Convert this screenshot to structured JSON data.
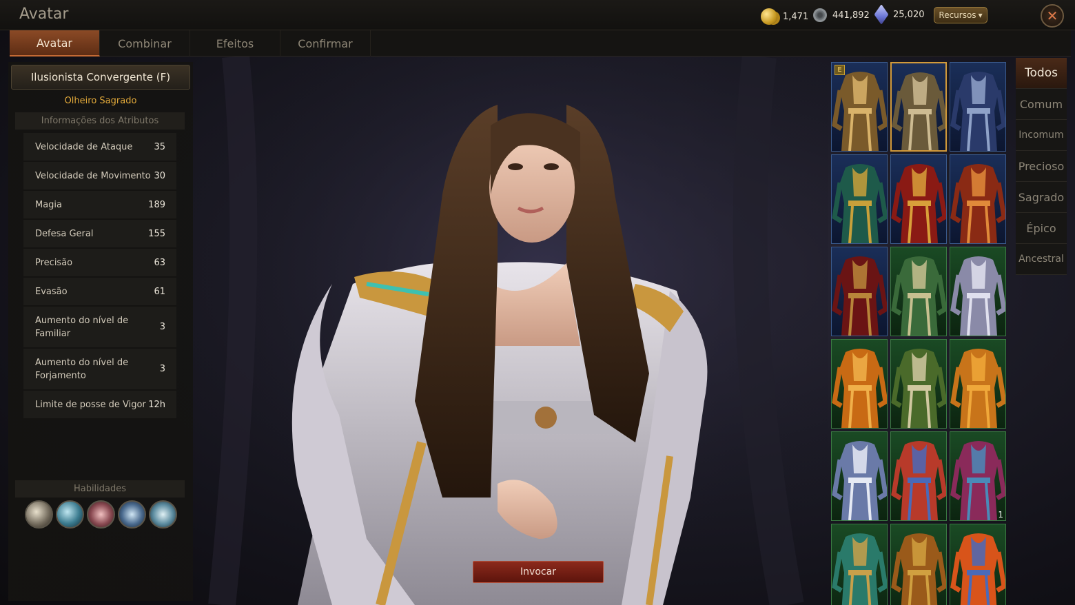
{
  "window": {
    "title": "Avatar"
  },
  "currencies": [
    {
      "icon": "gold-coin-icon",
      "value": "1,471"
    },
    {
      "icon": "silver-coin-icon",
      "value": "441,892"
    },
    {
      "icon": "crystal-icon",
      "value": "25,020"
    }
  ],
  "resources_button": {
    "label": "Recursos"
  },
  "tabs": [
    {
      "label": "Avatar",
      "active": true
    },
    {
      "label": "Combinar",
      "active": false
    },
    {
      "label": "Efeitos",
      "active": false
    },
    {
      "label": "Confirmar",
      "active": false
    }
  ],
  "character": {
    "class_name": "Ilusionista Convergente (F)",
    "grade": "Olheiro Sagrado",
    "attributes_header": "Informações dos Atributos",
    "attributes": [
      {
        "name": "Velocidade de Ataque",
        "value": "35"
      },
      {
        "name": "Velocidade de Movimento",
        "value": "30"
      },
      {
        "name": "Magia",
        "value": "189"
      },
      {
        "name": "Defesa Geral",
        "value": "155"
      },
      {
        "name": "Precisão",
        "value": "63"
      },
      {
        "name": "Evasão",
        "value": "61"
      },
      {
        "name": "Aumento do nível de Familiar",
        "value": "3"
      },
      {
        "name": "Aumento do nível de Forjamento",
        "value": "3"
      },
      {
        "name": "Limite de posse de Vigor",
        "value": "12h"
      }
    ],
    "skills_header": "Habilidades",
    "skills": [
      "wind-skill-icon",
      "lightning-skill-icon",
      "flame-skill-icon",
      "frost-orb-skill-icon",
      "ice-crystal-skill-icon"
    ]
  },
  "summon_button": {
    "label": "Invocar"
  },
  "filters": [
    {
      "label": "Todos",
      "active": true
    },
    {
      "label": "Comum",
      "active": false
    },
    {
      "label": "Incomum",
      "active": false
    },
    {
      "label": "Precioso",
      "active": false
    },
    {
      "label": "Sagrado",
      "active": false
    },
    {
      "label": "Épico",
      "active": false
    },
    {
      "label": "Ancestral",
      "active": false
    }
  ],
  "avatars": [
    {
      "grade": "blue",
      "colors": [
        "#7a5a2a",
        "#d9b36a"
      ],
      "badge": "E",
      "qty": ""
    },
    {
      "grade": "blue",
      "colors": [
        "#6a5a3a",
        "#cdbb92"
      ],
      "badge": "",
      "qty": "",
      "selected": true
    },
    {
      "grade": "blue",
      "colors": [
        "#2a3a6a",
        "#8fa2c8"
      ],
      "badge": "",
      "qty": ""
    },
    {
      "grade": "blue",
      "colors": [
        "#1e5a4a",
        "#c9a03a"
      ],
      "badge": "",
      "qty": ""
    },
    {
      "grade": "blue",
      "colors": [
        "#8a1a14",
        "#d8a03a"
      ],
      "badge": "",
      "qty": ""
    },
    {
      "grade": "blue",
      "colors": [
        "#8a2a14",
        "#e08a3a"
      ],
      "badge": "",
      "qty": ""
    },
    {
      "grade": "blue",
      "colors": [
        "#6a1414",
        "#b8863a"
      ],
      "badge": "",
      "qty": ""
    },
    {
      "grade": "green",
      "colors": [
        "#3a6a3a",
        "#c8c090"
      ],
      "badge": "",
      "qty": ""
    },
    {
      "grade": "green",
      "colors": [
        "#8a8aa8",
        "#e0e0ee"
      ],
      "badge": "",
      "qty": ""
    },
    {
      "grade": "green",
      "colors": [
        "#c86a14",
        "#f0b04a"
      ],
      "badge": "",
      "qty": ""
    },
    {
      "grade": "green",
      "colors": [
        "#4a6a2a",
        "#d0c8a0"
      ],
      "badge": "",
      "qty": ""
    },
    {
      "grade": "green",
      "colors": [
        "#c8741a",
        "#f0a83a"
      ],
      "badge": "",
      "qty": ""
    },
    {
      "grade": "green",
      "colors": [
        "#6a7aa8",
        "#e6eaf4"
      ],
      "badge": "",
      "qty": ""
    },
    {
      "grade": "green",
      "colors": [
        "#b83a2a",
        "#4a6ab8"
      ],
      "badge": "",
      "qty": ""
    },
    {
      "grade": "green",
      "colors": [
        "#8a2a5a",
        "#4a8ab8"
      ],
      "badge": "",
      "qty": "1"
    },
    {
      "grade": "green",
      "colors": [
        "#2a7a6a",
        "#c8a04a"
      ],
      "badge": "",
      "qty": ""
    },
    {
      "grade": "green",
      "colors": [
        "#9a5a1a",
        "#d0a040"
      ],
      "badge": "",
      "qty": ""
    },
    {
      "grade": "green",
      "colors": [
        "#d8541a",
        "#4a6ab8"
      ],
      "badge": "",
      "qty": ""
    }
  ]
}
